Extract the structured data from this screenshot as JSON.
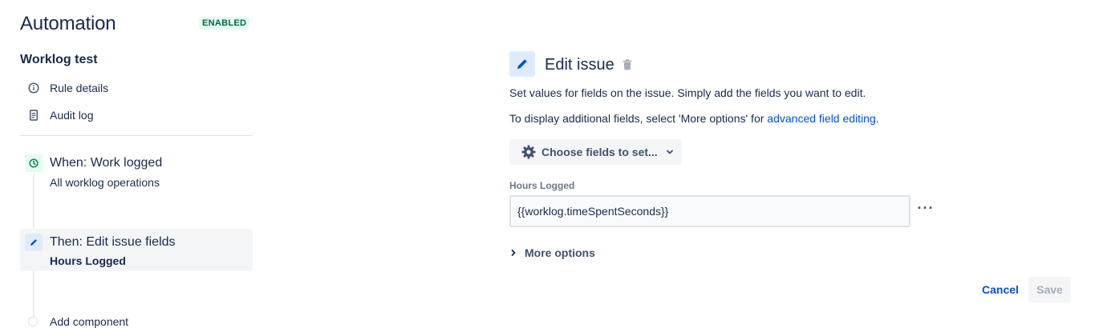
{
  "header": {
    "title": "Automation",
    "status": "ENABLED"
  },
  "sidebar": {
    "rule_name": "Worklog test",
    "links": [
      {
        "label": "Rule details",
        "icon": "info-icon"
      },
      {
        "label": "Audit log",
        "icon": "document-icon"
      }
    ],
    "steps": [
      {
        "title": "When: Work logged",
        "subtitle": "All worklog operations",
        "icon": "clock-icon"
      },
      {
        "title": "Then: Edit issue fields",
        "subtitle": "Hours Logged",
        "icon": "pencil-icon"
      }
    ],
    "add_component": "Add component"
  },
  "panel": {
    "title": "Edit issue",
    "description_1": "Set values for fields on the issue. Simply add the fields you want to edit.",
    "description_2_prefix": "To display additional fields, select 'More options' for ",
    "description_2_link": "advanced field editing",
    "description_2_suffix": ".",
    "choose_fields_label": "Choose fields to set...",
    "field": {
      "label": "Hours Logged",
      "value": "{{worklog.timeSpentSeconds}}"
    },
    "more_options_label": "More options",
    "cancel_label": "Cancel",
    "save_label": "Save"
  },
  "colors": {
    "accent": "#0052cc",
    "enabled_bg": "#e3fcef",
    "enabled_text": "#006644",
    "selected_step_bg": "#f4f5f7"
  }
}
